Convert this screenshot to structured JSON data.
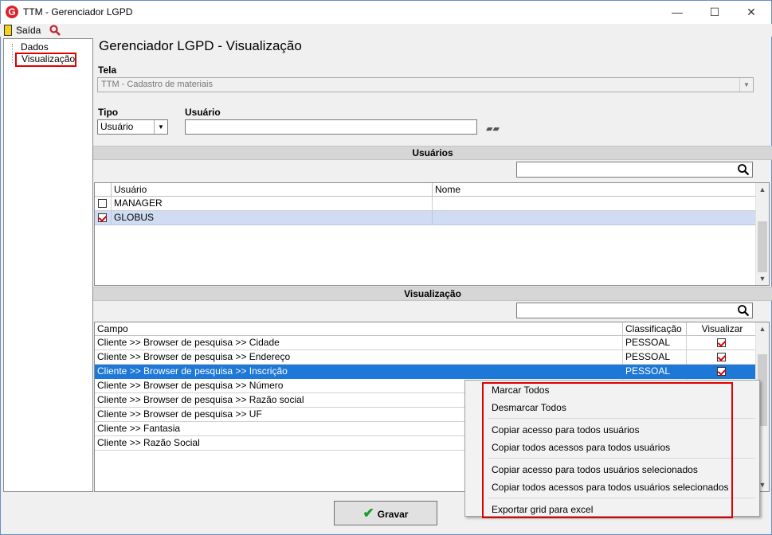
{
  "window": {
    "title": "TTM - Gerenciador LGPD",
    "app_icon_glyph": "G",
    "minimize": "—",
    "maximize": "☐",
    "close": "✕"
  },
  "toolbar": {
    "exit_label": "Saída",
    "exit_icon": "door-exit-icon",
    "search_icon": "search-icon"
  },
  "tree": {
    "items": [
      "Dados",
      "Visualização"
    ],
    "selected": "Visualização"
  },
  "page": {
    "title": "Gerenciador LGPD - Visualização"
  },
  "form": {
    "tela_label": "Tela",
    "tela_value": "TTM - Cadastro de materiais",
    "tipo_label": "Tipo",
    "tipo_value": "Usuário",
    "usuario_label": "Usuário",
    "usuario_value": ""
  },
  "users_section": {
    "title": "Usuários",
    "search_value": "",
    "columns": [
      "Usuário",
      "Nome"
    ],
    "rows": [
      {
        "usuario": "MANAGER",
        "nome": "",
        "checked": false
      },
      {
        "usuario": "GLOBUS",
        "nome": "",
        "checked": true
      }
    ]
  },
  "vis_section": {
    "title": "Visualização",
    "search_value": "",
    "columns": [
      "Campo",
      "Classificação",
      "Visualizar"
    ],
    "rows": [
      {
        "campo": "Cliente >> Browser de pesquisa >> Cidade",
        "classificacao": "PESSOAL",
        "visualizar": true
      },
      {
        "campo": "Cliente >> Browser de pesquisa >> Endereço",
        "classificacao": "PESSOAL",
        "visualizar": true
      },
      {
        "campo": "Cliente >> Browser de pesquisa >> Inscrição",
        "classificacao": "PESSOAL",
        "visualizar": true
      },
      {
        "campo": "Cliente >> Browser de pesquisa >> Número"
      },
      {
        "campo": "Cliente >> Browser de pesquisa >> Razão social"
      },
      {
        "campo": "Cliente >> Browser de pesquisa >> UF"
      },
      {
        "campo": "Cliente >> Fantasia"
      },
      {
        "campo": "Cliente >> Razão Social"
      }
    ]
  },
  "buttons": {
    "save_label": "Gravar"
  },
  "context_menu": {
    "items": [
      "Marcar Todos",
      "Desmarcar Todos",
      "Copiar acesso para todos usuários",
      "Copiar todos acessos para todos usuários",
      "Copiar acesso para todos usuários selecionados",
      "Copiar todos acessos para todos usuários selecionados",
      "Exportar grid para excel"
    ]
  },
  "colors": {
    "highlight_red": "#e00000",
    "selection_blue": "#1e78d7",
    "check_red": "#d00000"
  }
}
